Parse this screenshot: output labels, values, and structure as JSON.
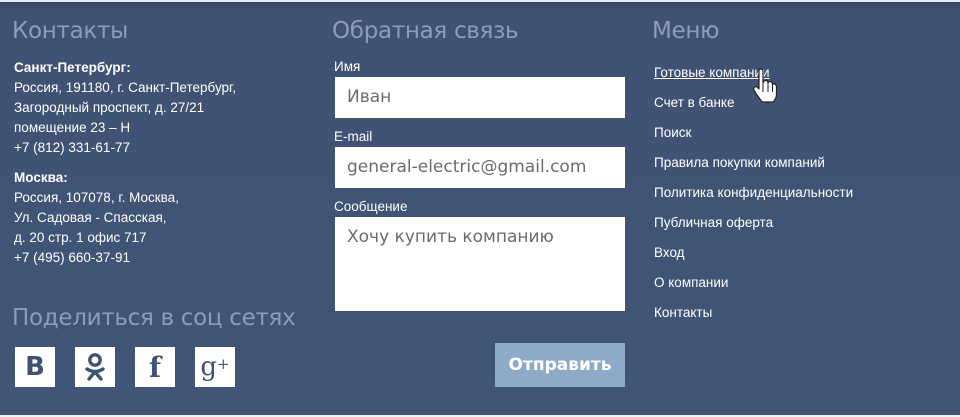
{
  "contacts": {
    "heading": "Контакты",
    "spb": {
      "city": "Санкт-Петербург:",
      "lines": [
        "Россия, 191180, г. Санкт-Петербург,",
        "Загородный проспект, д. 27/21",
        "помещение 23 – Н",
        "+7 (812) 331-61-77"
      ]
    },
    "moscow": {
      "city": "Москва:",
      "lines": [
        "Россия, 107078, г. Москва,",
        "Ул. Садовая - Спасская,",
        "д. 20 стр. 1 офис 717",
        "+7 (495) 660-37-91"
      ]
    }
  },
  "share": {
    "heading": "Поделиться в соц сетях",
    "icons": [
      {
        "name": "vk-icon",
        "glyph": "B"
      },
      {
        "name": "odnoklassniki-icon",
        "glyph": "ok"
      },
      {
        "name": "facebook-icon",
        "glyph": "f"
      },
      {
        "name": "google-plus-icon",
        "glyph": "g",
        "sup": "+"
      }
    ]
  },
  "feedback": {
    "heading": "Обратная связь",
    "name_label": "Имя",
    "name_value": "Иван",
    "email_label": "E-mail",
    "email_value": "general-electric@gmail.com",
    "message_label": "Сообщение",
    "message_value": "Хочу купить компанию",
    "submit_label": "Отправить"
  },
  "menu": {
    "heading": "Меню",
    "items": [
      {
        "label": "Готовые компании",
        "active": true
      },
      {
        "label": "Счет в банке"
      },
      {
        "label": "Поиск"
      },
      {
        "label": "Правила покупки компаний"
      },
      {
        "label": "Политика конфиденциальности"
      },
      {
        "label": "Публичная оферта"
      },
      {
        "label": "Вход"
      },
      {
        "label": "О компании"
      },
      {
        "label": "Контакты"
      }
    ]
  },
  "colors": {
    "background": "#415577",
    "heading": "#8f9cb8",
    "button": "#8eaac9"
  }
}
